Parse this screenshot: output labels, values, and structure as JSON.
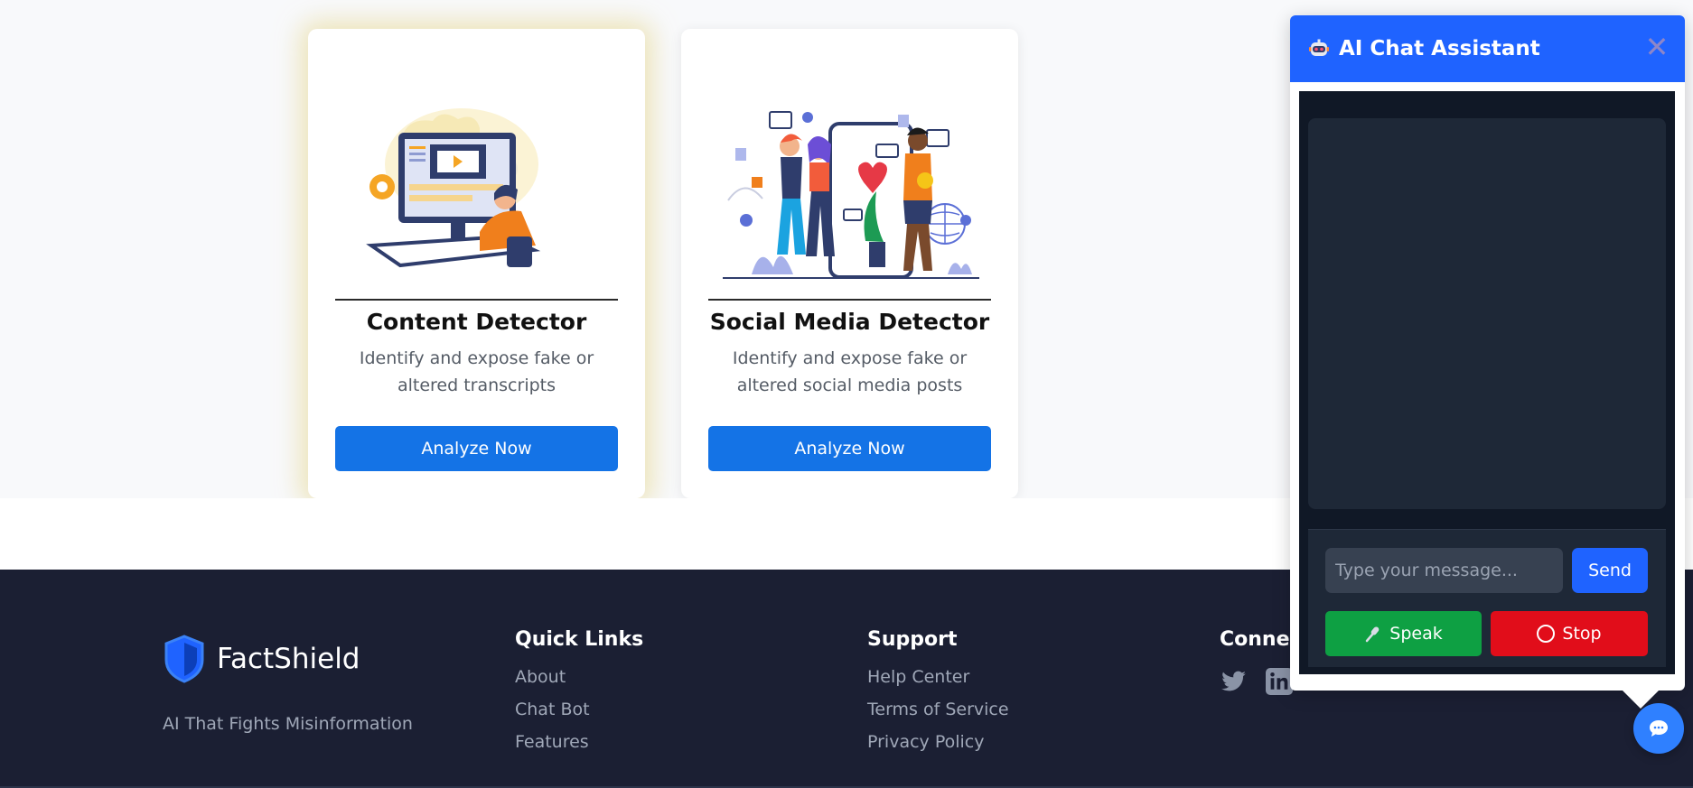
{
  "cards": [
    {
      "title": "Content Detector",
      "description": "Identify and expose fake or altered transcripts",
      "button_label": "Analyze Now"
    },
    {
      "title": "Social Media Detector",
      "description": "Identify and expose fake or altered social media posts",
      "button_label": "Analyze Now"
    }
  ],
  "footer": {
    "brand_name": "FactShield",
    "tagline": "AI That Fights Misinformation",
    "quick_links": {
      "title": "Quick Links",
      "items": [
        "About",
        "Chat Bot",
        "Features"
      ]
    },
    "support": {
      "title": "Support",
      "items": [
        "Help Center",
        "Terms of Service",
        "Privacy Policy"
      ]
    },
    "connect": {
      "title": "Connect",
      "icons": [
        "twitter-icon",
        "linkedin-icon"
      ]
    }
  },
  "chat": {
    "title": "AI Chat Assistant",
    "close_label": "✕",
    "input_placeholder": "Type your message...",
    "send_label": "Send",
    "speak_label": "Speak",
    "stop_label": "Stop"
  },
  "colors": {
    "primary_blue": "#1473e6",
    "chat_header": "#1f63ff",
    "footer_bg": "#1b1f33",
    "speak_green": "#0ea043",
    "stop_red": "#e10d1a"
  }
}
